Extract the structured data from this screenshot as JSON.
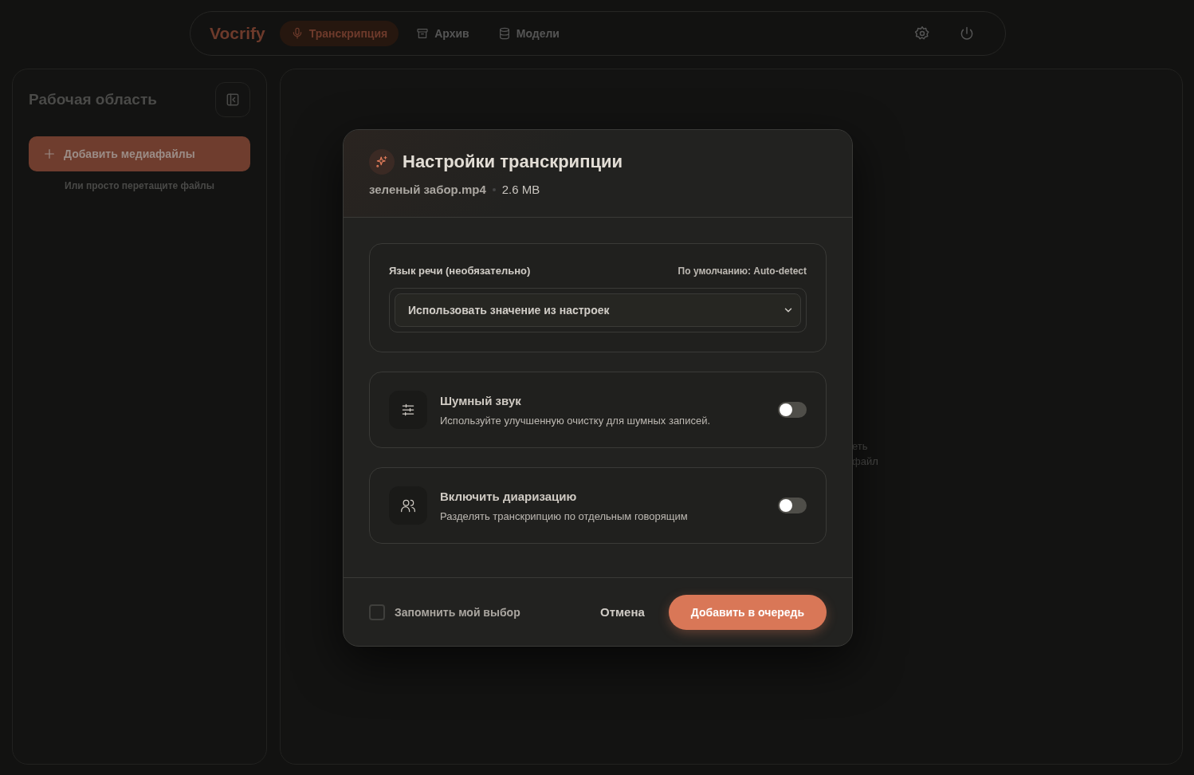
{
  "nav": {
    "logo": "Vocrify",
    "tabs": [
      {
        "label": "Транскрипция",
        "selected": true
      },
      {
        "label": "Архив",
        "selected": false
      },
      {
        "label": "Модели",
        "selected": false
      }
    ]
  },
  "sidebar": {
    "title": "Рабочая область",
    "add_button": "Добавить медиафайлы",
    "hint": "Или просто перетащите файлы"
  },
  "main": {
    "hint_lines": [
      "еть",
      "файл"
    ]
  },
  "dialog": {
    "title": "Настройки транскрипции",
    "file_name": "зеленый забор.mp4",
    "file_size": "2.6 MB",
    "language": {
      "label": "Язык речи (необязательно)",
      "default_note": "По умолчанию: Auto-detect",
      "value": "Использовать значение из настроек"
    },
    "options": [
      {
        "title": "Шумный звук",
        "description": "Используйте улучшенную очистку для шумных записей.",
        "on": false
      },
      {
        "title": "Включить диаризацию",
        "description": "Разделять транскрипцию по отдельным говорящим",
        "on": false
      }
    ],
    "remember": {
      "label": "Запомнить мой выбор",
      "checked": false
    },
    "cancel": "Отмена",
    "submit": "Добавить в очередь"
  }
}
